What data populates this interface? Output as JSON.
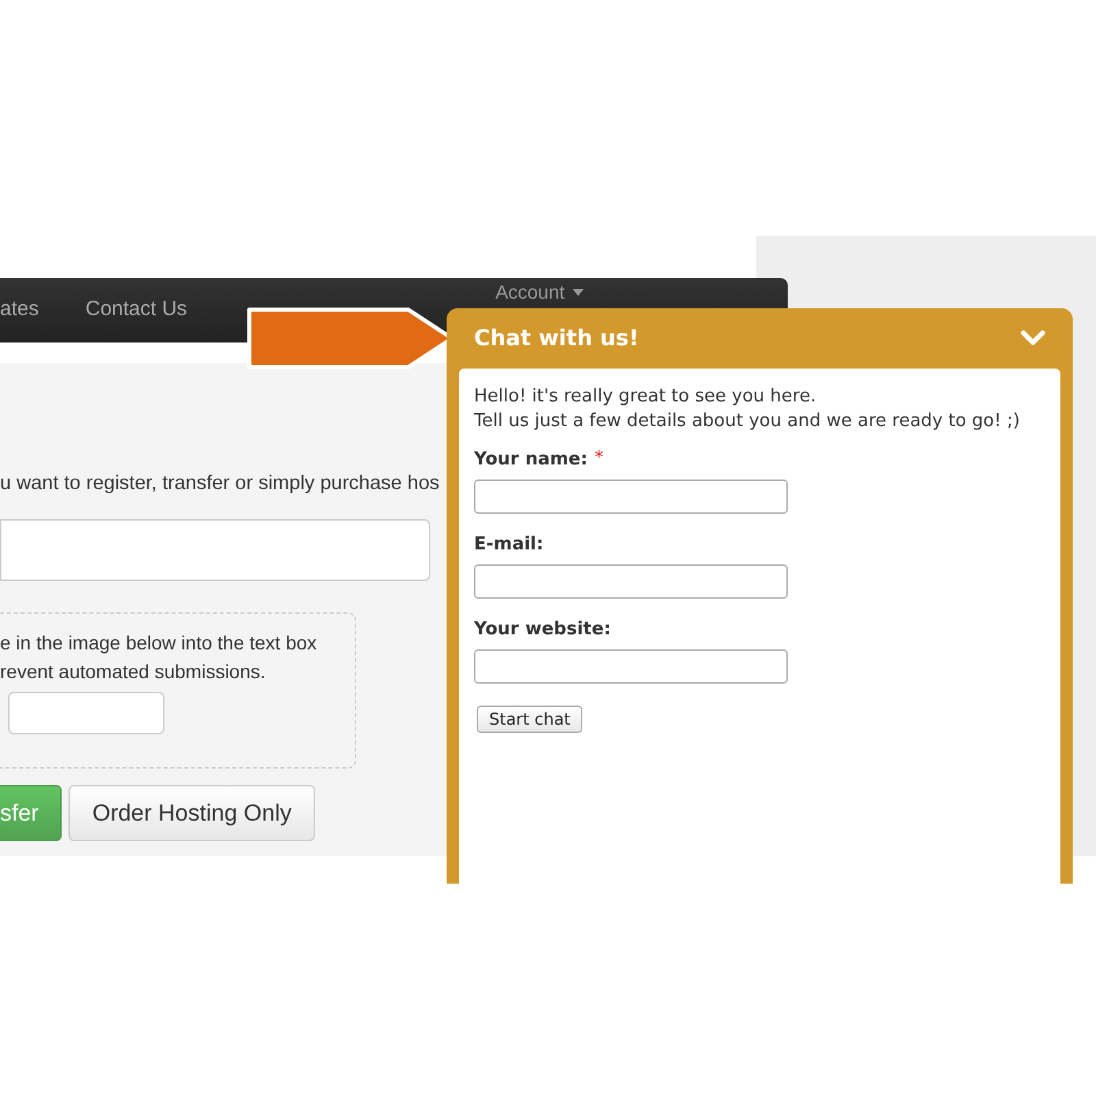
{
  "nav": {
    "items": [
      {
        "label": "ates"
      },
      {
        "label": "Contact Us"
      }
    ],
    "account": {
      "label": "Account"
    }
  },
  "page": {
    "intro": "u want to register, transfer or simply purchase hos",
    "captcha": {
      "lines": [
        "e in the image below into the text box",
        "revent automated submissions."
      ]
    },
    "buttons": [
      {
        "label": "sfer",
        "kind": "primary"
      },
      {
        "label": "Order Hosting Only",
        "kind": "default"
      }
    ]
  },
  "chat": {
    "title": "Chat with us!",
    "greeting": [
      "Hello! it's really great to see you here.",
      "Tell us just a few details about you and we are ready to go! ;)"
    ],
    "fields": [
      {
        "label": "Your name:",
        "required_mark": "*"
      },
      {
        "label": "E-mail:"
      },
      {
        "label": "Your website:"
      }
    ],
    "submit": "Start chat"
  }
}
